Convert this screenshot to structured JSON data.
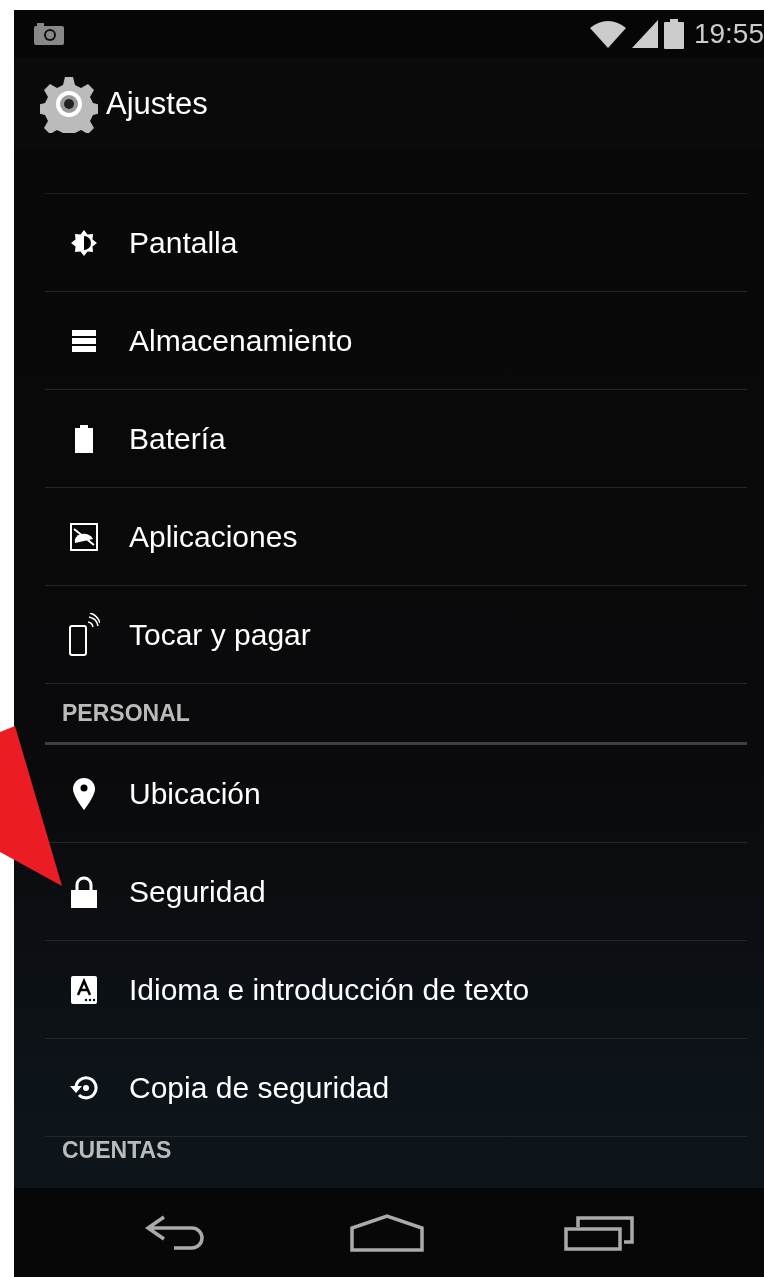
{
  "status_bar": {
    "time": "19:55"
  },
  "action_bar": {
    "title": "Ajustes"
  },
  "list": [
    {
      "kind": "item",
      "label": "Pantalla"
    },
    {
      "kind": "item",
      "label": "Almacenamiento"
    },
    {
      "kind": "item",
      "label": "Batería"
    },
    {
      "kind": "item",
      "label": "Aplicaciones"
    },
    {
      "kind": "item",
      "label": "Tocar y pagar"
    },
    {
      "kind": "header",
      "label": "PERSONAL"
    },
    {
      "kind": "item",
      "label": "Ubicación"
    },
    {
      "kind": "item",
      "label": "Seguridad"
    },
    {
      "kind": "item",
      "label": "Idioma e introducción de texto"
    },
    {
      "kind": "item",
      "label": "Copia de seguridad"
    },
    {
      "kind": "header",
      "label": "CUENTAS"
    }
  ]
}
